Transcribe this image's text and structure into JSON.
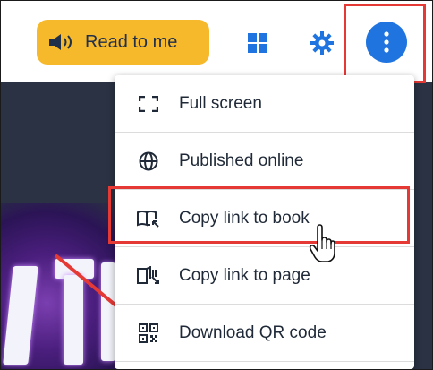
{
  "toolbar": {
    "read_to_me_label": "Read to me",
    "icons": [
      "speaker-icon",
      "grid-icon",
      "gear-icon",
      "more-vertical-icon"
    ]
  },
  "menu": {
    "items": [
      {
        "label": "Full screen",
        "icon": "fullscreen-icon"
      },
      {
        "label": "Published online",
        "icon": "globe-icon"
      },
      {
        "label": "Copy link to book",
        "icon": "book-link-icon"
      },
      {
        "label": "Copy link to page",
        "icon": "page-link-icon"
      },
      {
        "label": "Download QR code",
        "icon": "qr-code-icon"
      }
    ]
  },
  "colors": {
    "read_button": "#f7b92c",
    "accent_blue": "#1f74e0",
    "highlight_red": "#e53935",
    "dark_background": "#2a3243"
  }
}
